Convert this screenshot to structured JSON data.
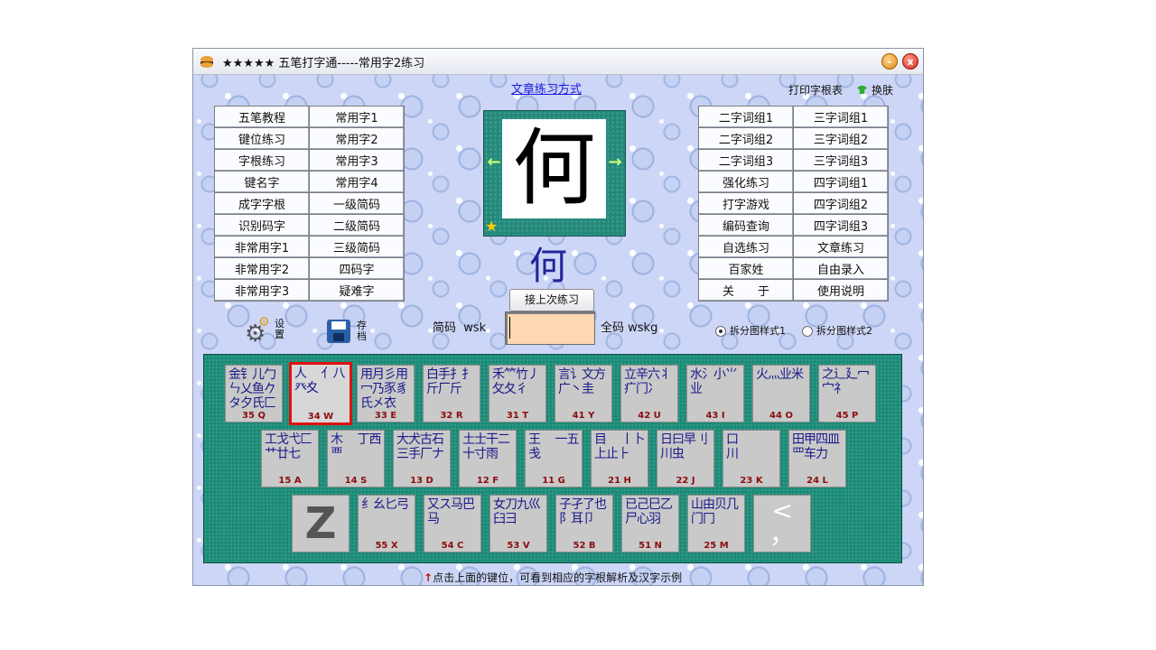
{
  "window": {
    "title": "★★★★★ 五笔打字通-----常用字2练习",
    "min_label": "–",
    "close_label": "x"
  },
  "top_link": "文章练习方式",
  "print_link": "打印字根表",
  "skin_link": "换肤",
  "left_menu": [
    [
      "五笔教程",
      "常用字1"
    ],
    [
      "键位练习",
      "常用字2"
    ],
    [
      "字根练习",
      "常用字3"
    ],
    [
      "键名字",
      "常用字4"
    ],
    [
      "成字字根",
      "一级简码"
    ],
    [
      "识别码字",
      "二级简码"
    ],
    [
      "非常用字1",
      "三级简码"
    ],
    [
      "非常用字2",
      "四码字"
    ],
    [
      "非常用字3",
      "疑难字"
    ]
  ],
  "right_menu": [
    [
      "二字词组1",
      "三字词组1"
    ],
    [
      "二字词组2",
      "三字词组2"
    ],
    [
      "二字词组3",
      "三字词组3"
    ],
    [
      "强化练习",
      "四字词组1"
    ],
    [
      "打字游戏",
      "四字词组2"
    ],
    [
      "编码查询",
      "四字词组3"
    ],
    [
      "自选练习",
      "文章练习"
    ],
    [
      "百家姓",
      "自由录入"
    ],
    [
      "关　　于",
      "使用说明"
    ]
  ],
  "current_char": "何",
  "arrows": {
    "prev": "←",
    "next": "→"
  },
  "star": "★",
  "continue_button": "接上次练习",
  "settings_label": "设置",
  "save_label": "存档",
  "short_code": {
    "label": "简码",
    "value": "wsk"
  },
  "full_code": {
    "label": "全码",
    "value": "wskg"
  },
  "radio_options": [
    {
      "label": "拆分图样式1",
      "selected": true
    },
    {
      "label": "拆分图样式2",
      "selected": false
    }
  ],
  "keys_row1": [
    {
      "roots": "金钅儿勹ㄣ乂鱼𠂊タ夕氏匚",
      "code": "35 Q",
      "selected": false
    },
    {
      "roots": "人　 亻八癶夊",
      "code": "34 W",
      "selected": true
    },
    {
      "roots": "用月彡用冖乃豕豸氏㐅衣",
      "code": "33 E",
      "selected": false
    },
    {
      "roots": "白手扌⺘斤厂斤",
      "code": "32 R",
      "selected": false
    },
    {
      "roots": "禾⺮竹丿攵夂彳",
      "code": "31 T",
      "selected": false
    },
    {
      "roots": "言讠文方广丶圭",
      "code": "41 Y",
      "selected": false
    },
    {
      "roots": "立辛六丬疒门冫",
      "code": "42 U",
      "selected": false
    },
    {
      "roots": "水氵小⺌业",
      "code": "43 I",
      "selected": false
    },
    {
      "roots": "火灬业米",
      "code": "44 O",
      "selected": false
    },
    {
      "roots": "之辶廴冖宀礻",
      "code": "45 P",
      "selected": false
    }
  ],
  "keys_row2": [
    {
      "roots": "工戈弋匚艹廿七",
      "code": "15 A"
    },
    {
      "roots": "木　 丁西　 覀",
      "code": "14 S"
    },
    {
      "roots": "大犬古石三手厂ナ",
      "code": "13 D"
    },
    {
      "roots": "土士干二十寸雨",
      "code": "12 F"
    },
    {
      "roots": "王　 一五　 戋",
      "code": "11 G"
    },
    {
      "roots": "目　 丨卜上止⺊",
      "code": "21 H"
    },
    {
      "roots": "日曰早刂川虫",
      "code": "22 J"
    },
    {
      "roots": "口　 　 川",
      "code": "23 K"
    },
    {
      "roots": "田甲四皿罒车力",
      "code": "24 L"
    }
  ],
  "key_z": "Z",
  "keys_row3": [
    {
      "roots": "纟幺匕弓",
      "code": "55 X"
    },
    {
      "roots": "又ス马巴　 马",
      "code": "54 C"
    },
    {
      "roots": "女刀九巛臼彐",
      "code": "53 V"
    },
    {
      "roots": "子孑了也阝耳卩",
      "code": "52 B"
    },
    {
      "roots": "已己巳乙尸心羽",
      "code": "51 N"
    },
    {
      "roots": "山由贝几门冂",
      "code": "25 M"
    }
  ],
  "key_comma": "<\n，",
  "hint": {
    "arrow": "↑",
    "text": "点击上面的键位，可看到相应的字根解析及汉字示例"
  }
}
